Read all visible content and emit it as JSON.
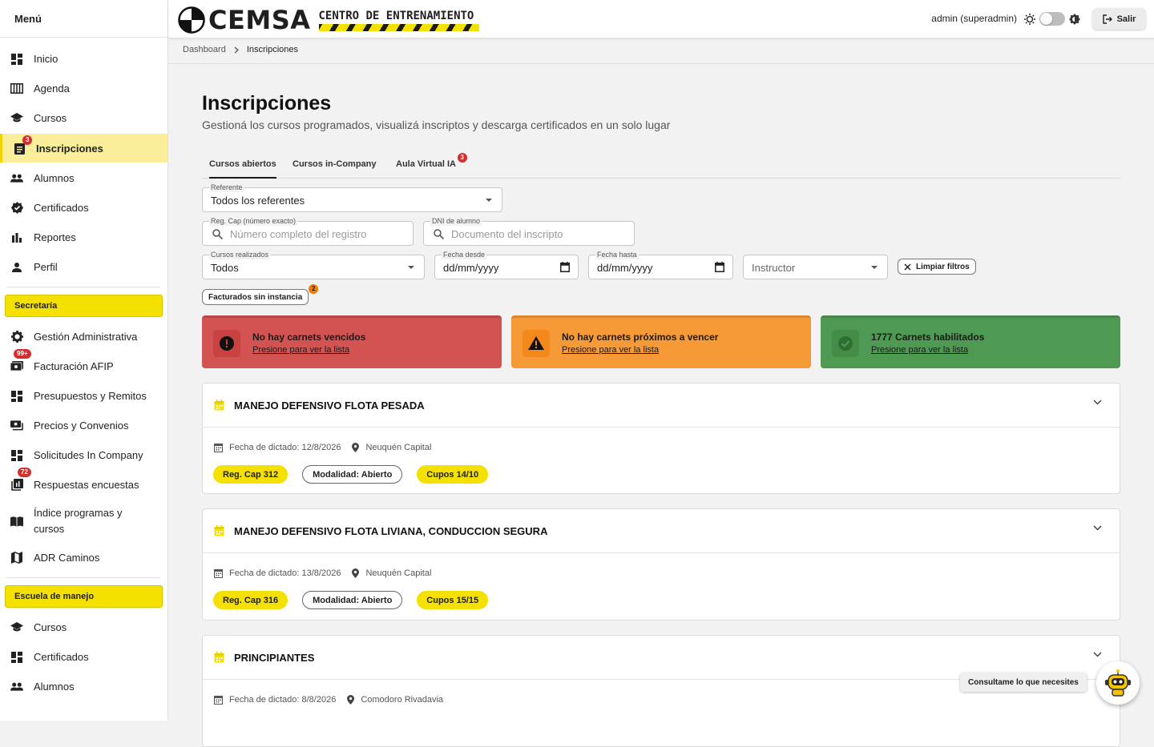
{
  "sidebar": {
    "title": "Menú",
    "items": [
      {
        "label": "Inicio",
        "icon": "dashboard-icon"
      },
      {
        "label": "Agenda",
        "icon": "calendar-view-icon"
      },
      {
        "label": "Cursos",
        "icon": "school-icon"
      },
      {
        "label": "Inscripciones",
        "icon": "assignment-icon",
        "badge": "3",
        "active": true
      },
      {
        "label": "Alumnos",
        "icon": "people-icon"
      },
      {
        "label": "Certificados",
        "icon": "verified-icon"
      },
      {
        "label": "Reportes",
        "icon": "bar-chart-icon"
      },
      {
        "label": "Perfil",
        "icon": "person-icon"
      }
    ],
    "sections": [
      {
        "title": "Secretaría",
        "items": [
          {
            "label": "Gestión Administrativa",
            "icon": "gear-icon"
          },
          {
            "label": "Facturación AFIP",
            "icon": "invoice-icon",
            "badge": "99+"
          },
          {
            "label": "Presupuestos y Remitos",
            "icon": "dashboard-icon"
          },
          {
            "label": "Precios y Convenios",
            "icon": "payments-icon"
          },
          {
            "label": "Solicitudes In Company",
            "icon": "dashboard-icon"
          },
          {
            "label": "Respuestas encuestas",
            "icon": "poll-icon",
            "badge": "72"
          },
          {
            "label": "Índice programas y cursos",
            "icon": "book-icon"
          },
          {
            "label": "ADR Caminos",
            "icon": "map-icon"
          }
        ]
      },
      {
        "title": "Escuela de manejo",
        "items": [
          {
            "label": "Cursos",
            "icon": "school-icon"
          },
          {
            "label": "Certificados",
            "icon": "dashboard-icon"
          },
          {
            "label": "Alumnos",
            "icon": "people-icon"
          }
        ]
      }
    ]
  },
  "header": {
    "brand": "CEMSA",
    "brand_sub": "CENTRO DE ENTRENAMIENTO",
    "user": "admin (superadmin)",
    "logout_label": "Salir"
  },
  "breadcrumb": {
    "root": "Dashboard",
    "current": "Inscripciones"
  },
  "page": {
    "title": "Inscripciones",
    "subtitle": "Gestioná los cursos programados, visualizá inscriptos y descarga certificados en un solo lugar"
  },
  "tabs": [
    {
      "label": "Cursos abiertos",
      "active": true
    },
    {
      "label": "Cursos in-Company"
    },
    {
      "label": "Aula Virtual IA",
      "badge": "3"
    }
  ],
  "filters": {
    "referente": {
      "label": "Referente",
      "value": "Todos los referentes"
    },
    "regcap": {
      "label": "Reg. Cap (número exacto)",
      "placeholder": "Número completo del registro"
    },
    "dni": {
      "label": "DNI de alumno",
      "placeholder": "Documento del inscripto"
    },
    "cursos_realizados": {
      "label": "Cursos realizados",
      "value": "Todos"
    },
    "fecha_desde": {
      "label": "Fecha desde",
      "value": "dd/mm/yyyy"
    },
    "fecha_hasta": {
      "label": "Fecha hasta",
      "value": "dd/mm/yyyy"
    },
    "instructor": {
      "placeholder": "Instructor"
    },
    "clear_label": "Limpiar filtros",
    "facturados_label": "Facturados sin instancia",
    "facturados_badge": "2"
  },
  "status_cards": [
    {
      "title": "No hay carnets vencidos",
      "link": "Presione para ver la lista",
      "color": "#d35352",
      "icon_bg": "#c94242"
    },
    {
      "title": "No hay carnets próximos a vencer",
      "link": "Presione para ver la lista",
      "color": "#f59a36",
      "icon_bg": "#f3891b"
    },
    {
      "title": "1777 Carnets habilitados",
      "link": "Presione para ver la lista",
      "color": "#4f9a53",
      "icon_bg": "#438d47"
    }
  ],
  "courses": [
    {
      "title": "MANEJO DEFENSIVO FLOTA PESADA",
      "date": "Fecha de dictado: 12/8/2026",
      "location": "Neuquén Capital",
      "regcap": "Reg. Cap 312",
      "modalidad": "Modalidad: Abierto",
      "cupos": "Cupos 14/10"
    },
    {
      "title": "MANEJO DEFENSIVO FLOTA LIVIANA, CONDUCCION SEGURA",
      "date": "Fecha de dictado: 13/8/2026",
      "location": "Neuquén Capital",
      "regcap": "Reg. Cap 316",
      "modalidad": "Modalidad: Abierto",
      "cupos": "Cupos 15/15"
    },
    {
      "title": "PRINCIPIANTES",
      "date": "Fecha de dictado: 8/8/2026",
      "location": "Comodoro Rivadavia"
    }
  ],
  "assistant": {
    "tip": "Consultame lo que necesites"
  },
  "colors": {
    "accent": "#f5e100",
    "active_bg": "#fbee9b"
  }
}
